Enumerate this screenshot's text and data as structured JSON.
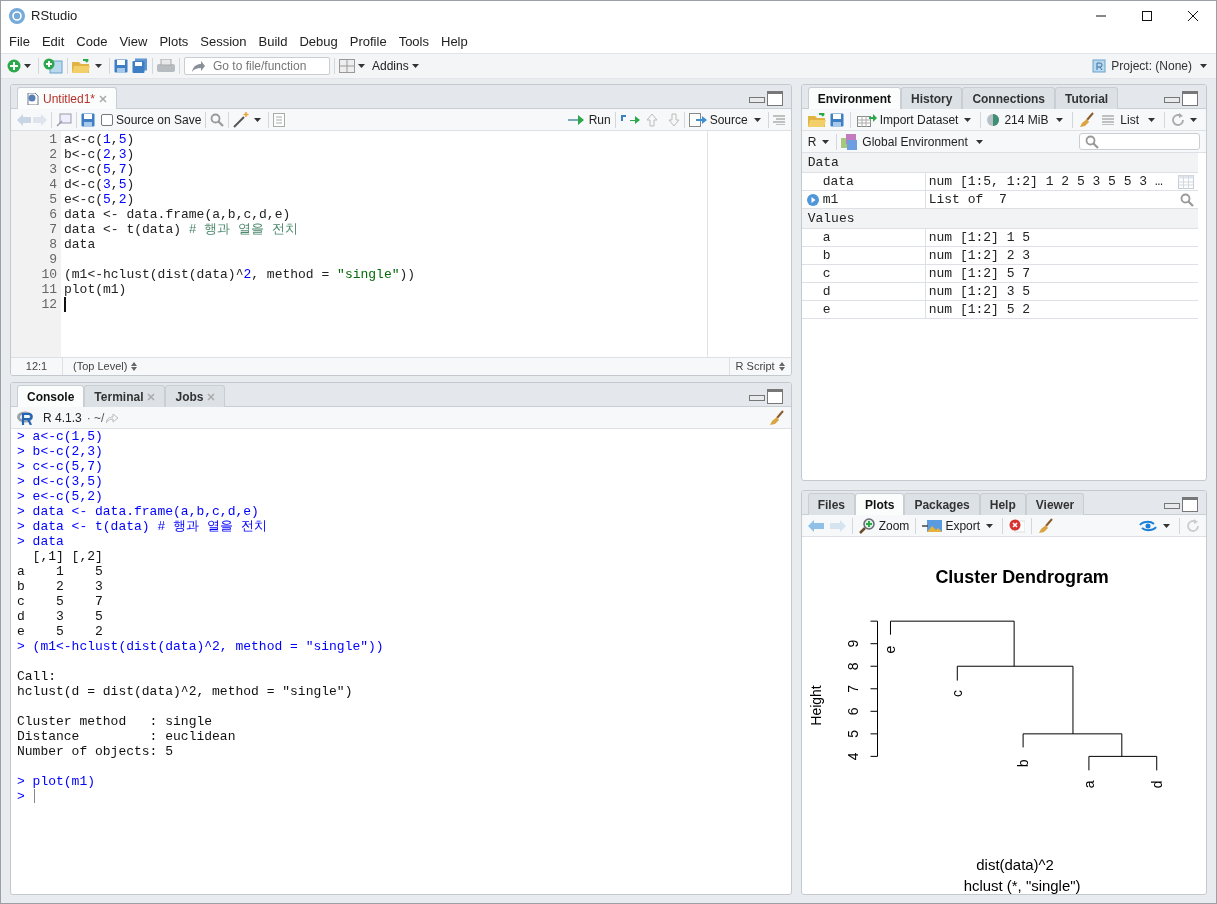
{
  "window": {
    "title": "RStudio"
  },
  "menu": [
    "File",
    "Edit",
    "Code",
    "View",
    "Plots",
    "Session",
    "Build",
    "Debug",
    "Profile",
    "Tools",
    "Help"
  ],
  "toolbar": {
    "goto_placeholder": "Go to file/function",
    "addins": "Addins",
    "project": "Project: (None)"
  },
  "editor": {
    "tabs": [
      {
        "label": "Untitled1*",
        "modified": true,
        "selected": true
      }
    ],
    "source_on_save": {
      "label": "Source on Save",
      "checked": false
    },
    "run": "Run",
    "source": "Source",
    "lines": [
      {
        "n": "1",
        "code": "a<-c(1,5)"
      },
      {
        "n": "2",
        "code": "b<-c(2,3)"
      },
      {
        "n": "3",
        "code": "c<-c(5,7)"
      },
      {
        "n": "4",
        "code": "d<-c(3,5)"
      },
      {
        "n": "5",
        "code": "e<-c(5,2)"
      },
      {
        "n": "6",
        "code": "data <- data.frame(a,b,c,d,e)"
      },
      {
        "n": "7",
        "code": "data <- t(data) # 행과 열을 전치"
      },
      {
        "n": "8",
        "code": "data"
      },
      {
        "n": "9"
      },
      {
        "n": "10",
        "code": "(m1<-hclust(dist(data)^2, method = \"single\"))"
      },
      {
        "n": "11",
        "code": "plot(m1)"
      },
      {
        "n": "12",
        "cursor": true
      }
    ],
    "status": {
      "position": "12:1",
      "scope": "(Top Level)",
      "type": "R Script"
    }
  },
  "console": {
    "tabs": [
      {
        "label": "Console",
        "selected": true,
        "closable": false
      },
      {
        "label": "Terminal",
        "selected": false,
        "closable": true
      },
      {
        "label": "Jobs",
        "selected": false,
        "closable": true
      }
    ],
    "version": "R 4.1.3",
    "path": "· ~/",
    "lines": [
      {
        "kind": "input",
        "text": "> a<-c(1,5)"
      },
      {
        "kind": "input",
        "text": "> b<-c(2,3)"
      },
      {
        "kind": "input",
        "text": "> c<-c(5,7)"
      },
      {
        "kind": "input",
        "text": "> d<-c(3,5)"
      },
      {
        "kind": "input",
        "text": "> e<-c(5,2)"
      },
      {
        "kind": "input",
        "text": "> data <- data.frame(a,b,c,d,e)"
      },
      {
        "kind": "input",
        "text": "> data <- t(data) # 행과 열을 전치"
      },
      {
        "kind": "input",
        "text": "> data"
      },
      {
        "kind": "output",
        "text": "  [,1] [,2]"
      },
      {
        "kind": "output",
        "text": "a    1    5"
      },
      {
        "kind": "output",
        "text": "b    2    3"
      },
      {
        "kind": "output",
        "text": "c    5    7"
      },
      {
        "kind": "output",
        "text": "d    3    5"
      },
      {
        "kind": "output",
        "text": "e    5    2"
      },
      {
        "kind": "input",
        "text": "> (m1<-hclust(dist(data)^2, method = \"single\"))"
      },
      {
        "kind": "blank"
      },
      {
        "kind": "output",
        "text": "Call:"
      },
      {
        "kind": "output",
        "text": "hclust(d = dist(data)^2, method = \"single\")"
      },
      {
        "kind": "blank"
      },
      {
        "kind": "output",
        "text": "Cluster method   : single "
      },
      {
        "kind": "output",
        "text": "Distance         : euclidean "
      },
      {
        "kind": "output",
        "text": "Number of objects: 5 "
      },
      {
        "kind": "blank"
      },
      {
        "kind": "input",
        "text": "> plot(m1)"
      },
      {
        "kind": "prompt",
        "text": ">"
      }
    ]
  },
  "environment": {
    "tabs": [
      {
        "label": "Environment",
        "selected": true
      },
      {
        "label": "History",
        "selected": false
      },
      {
        "label": "Connections",
        "selected": false
      },
      {
        "label": "Tutorial",
        "selected": false
      }
    ],
    "import": "Import Dataset",
    "memory": "214 MiB",
    "view": "List",
    "language": "R",
    "scope": "Global Environment",
    "sections": [
      {
        "title": "Data",
        "rows": [
          {
            "name": "data",
            "value": "num [1:5, 1:2] 1 2 5 3 5 5 3 …",
            "kind": "grid",
            "expandable": false
          },
          {
            "name": "m1",
            "value": "List of  7",
            "kind": "search",
            "expandable": true
          }
        ]
      },
      {
        "title": "Values",
        "rows": [
          {
            "name": "a",
            "value": "num [1:2] 1 5",
            "kind": "plain",
            "expandable": false
          },
          {
            "name": "b",
            "value": "num [1:2] 2 3",
            "kind": "plain",
            "expandable": false
          },
          {
            "name": "c",
            "value": "num [1:2] 5 7",
            "kind": "plain",
            "expandable": false
          },
          {
            "name": "d",
            "value": "num [1:2] 3 5",
            "kind": "plain",
            "expandable": false
          },
          {
            "name": "e",
            "value": "num [1:2] 5 2",
            "kind": "plain",
            "expandable": false
          }
        ]
      }
    ]
  },
  "plots": {
    "tabs": [
      {
        "label": "Files",
        "selected": false
      },
      {
        "label": "Plots",
        "selected": true
      },
      {
        "label": "Packages",
        "selected": false
      },
      {
        "label": "Help",
        "selected": false
      },
      {
        "label": "Viewer",
        "selected": false
      }
    ],
    "zoom": "Zoom",
    "export": "Export",
    "plot": {
      "title": "Cluster Dendrogram",
      "ylabel": "Height",
      "yticks": [
        "4",
        "5",
        "6",
        "7",
        "8",
        "9"
      ],
      "leaves": [
        "e",
        "c",
        "b",
        "a",
        "d"
      ],
      "xlabel": "dist(data)^2",
      "subtitle": "hclust (*, \"single\")"
    }
  }
}
